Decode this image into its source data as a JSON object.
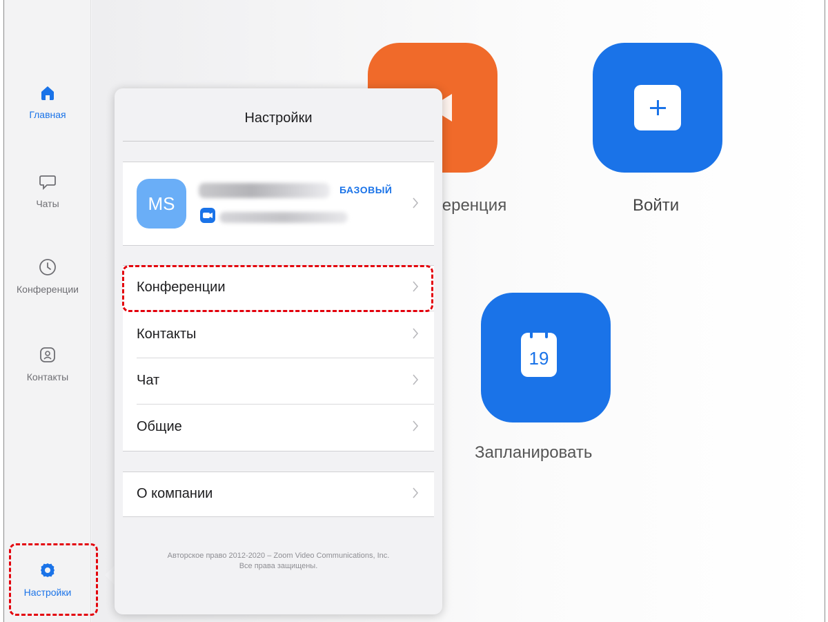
{
  "sidebar": {
    "items": [
      {
        "label": "Главная",
        "icon": "home-icon",
        "active": true
      },
      {
        "label": "Чаты",
        "icon": "chat-bubble-icon",
        "active": false
      },
      {
        "label": "Конференции",
        "icon": "clock-icon",
        "active": false
      },
      {
        "label": "Контакты",
        "icon": "contact-icon",
        "active": false
      },
      {
        "label": "Настройки",
        "icon": "gear-icon",
        "active": true
      }
    ]
  },
  "home": {
    "tiles": [
      {
        "label": "Конференция",
        "label_visible": "ференция",
        "icon": "video-camera-icon",
        "color": "#f06a2a"
      },
      {
        "label": "Войти",
        "icon": "plus-icon",
        "color": "#1a73e8"
      },
      {
        "label": "Запланировать",
        "icon": "calendar-icon",
        "day": "19",
        "color": "#1a73e8"
      }
    ]
  },
  "settings": {
    "title": "Настройки",
    "profile": {
      "initials": "MS",
      "plan": "БАЗОВЫЙ"
    },
    "menu": [
      {
        "label": "Конференции"
      },
      {
        "label": "Контакты"
      },
      {
        "label": "Чат"
      },
      {
        "label": "Общие"
      }
    ],
    "about": {
      "label": "О компании"
    },
    "footer_line1": "Авторское право 2012-2020 – Zoom Video Communications, Inc.",
    "footer_line2": "Все права защищены."
  },
  "colors": {
    "accent": "#1a73e8",
    "orange": "#f06a2a",
    "highlight": "#e3000b"
  }
}
